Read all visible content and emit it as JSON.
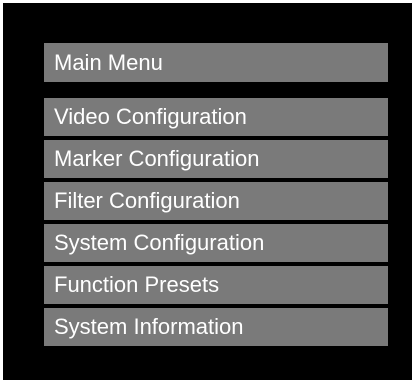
{
  "menu": {
    "title": "Main Menu",
    "items": [
      {
        "label": "Video Configuration"
      },
      {
        "label": "Marker Configuration"
      },
      {
        "label": "Filter Configuration"
      },
      {
        "label": "System Configuration"
      },
      {
        "label": "Function Presets"
      },
      {
        "label": "System Information"
      }
    ]
  },
  "colors": {
    "background": "#000000",
    "item_background": "#7a7a7a",
    "text": "#ffffff",
    "frame": "#ffffff"
  }
}
